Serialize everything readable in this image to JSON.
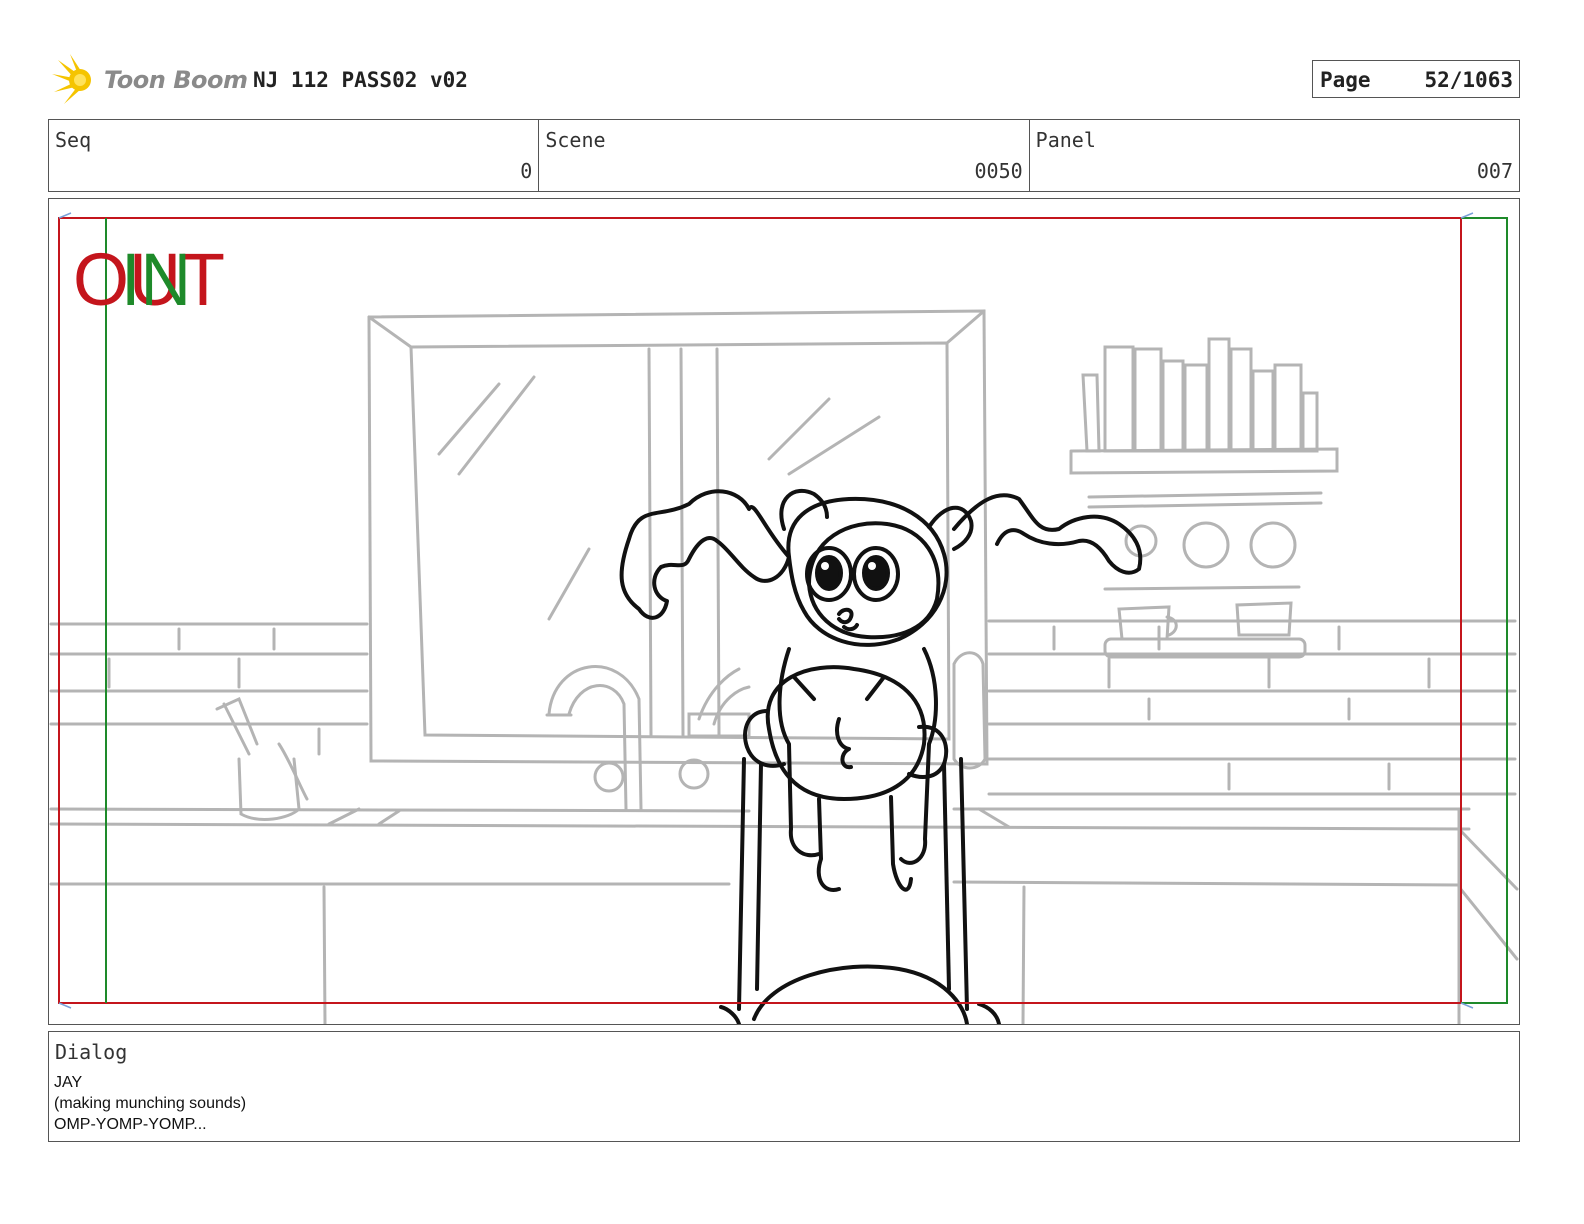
{
  "header": {
    "brand": "Toon Boom",
    "title": "NJ 112 PASS02 v02",
    "page_label": "Page",
    "page_value": "52/1063"
  },
  "info": {
    "seq_label": "Seq",
    "seq_value": "0",
    "scene_label": "Scene",
    "scene_value": "0050",
    "panel_label": "Panel",
    "panel_value": "007"
  },
  "panel": {
    "marker_out": "OUT",
    "marker_in": "IN",
    "colors": {
      "out": "#c4151c",
      "in": "#1e8a2a",
      "sketch": "#b4b4b4",
      "ink": "#111111"
    }
  },
  "dialog": {
    "label": "Dialog",
    "lines": [
      "JAY",
      "(making munching sounds)",
      "OMP-YOMP-YOMP..."
    ]
  }
}
